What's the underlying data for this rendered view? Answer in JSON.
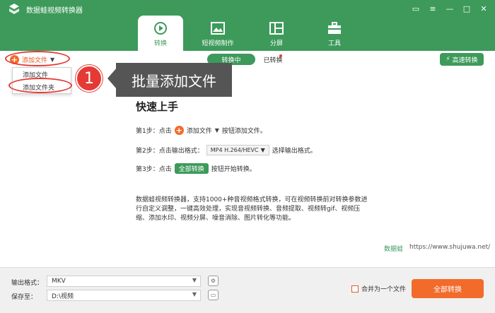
{
  "app": {
    "title": "数据蛙视频转换器",
    "logo_icon": "app-logo-icon"
  },
  "window_controls": [
    {
      "name": "feedback-icon",
      "glyph": "▭"
    },
    {
      "name": "settings-icon",
      "glyph": "≡"
    },
    {
      "name": "minimize-icon",
      "glyph": "—"
    },
    {
      "name": "maximize-icon",
      "glyph": "□"
    },
    {
      "name": "close-icon",
      "glyph": "✕"
    }
  ],
  "nav_tabs": [
    {
      "label": "转换",
      "icon": "convert-icon",
      "active": true
    },
    {
      "label": "短视频制作",
      "icon": "image-icon",
      "active": false
    },
    {
      "label": "分屏",
      "icon": "split-screen-icon",
      "active": false
    },
    {
      "label": "工具",
      "icon": "toolbox-icon",
      "active": false
    }
  ],
  "toolbar": {
    "add_file_label": "添加文件",
    "seg_converting": "转换中",
    "seg_converted": "已转换",
    "high_speed_label": "高速转换"
  },
  "dropdown": {
    "items": [
      "添加文件",
      "添加文件夹"
    ]
  },
  "annotation": {
    "number": "1",
    "text": "批量添加文件"
  },
  "quick_start": {
    "title": "快速上手",
    "step1_prefix": "第1步：点击",
    "step1_button": "添加文件",
    "step1_suffix": "按钮添加文件。",
    "step2_prefix": "第2步：点击输出格式：",
    "step2_format": "MP4 H.264/HEVC",
    "step2_suffix": "选择输出格式。",
    "step3_prefix": "第3步：点击",
    "step3_button": "全部转换",
    "step3_suffix": "按钮开始转换。",
    "description": "数据蛙视频转换器，支持1000+种音视频格式转换，可在视频转换前对转换参数进行自定义调整，一键高效处理，实现音视频转换、音频提取、视频转gif、视频压缩、添加水印、视频分屏、噪音消除、图片转化等功能。"
  },
  "footer_brand": {
    "name": "数据蛙",
    "url": "https://www.shujuwa.net/"
  },
  "bottom": {
    "output_format_label": "输出格式：",
    "output_format_value": "MKV",
    "save_to_label": "保存至：",
    "save_to_value": "D:\\视频",
    "merge_label": "合并为一个文件",
    "convert_all_label": "全部转换"
  },
  "colors": {
    "brand_green": "#3d9a5b",
    "accent_orange": "#f26b2b",
    "annotation_red": "#e53935"
  }
}
